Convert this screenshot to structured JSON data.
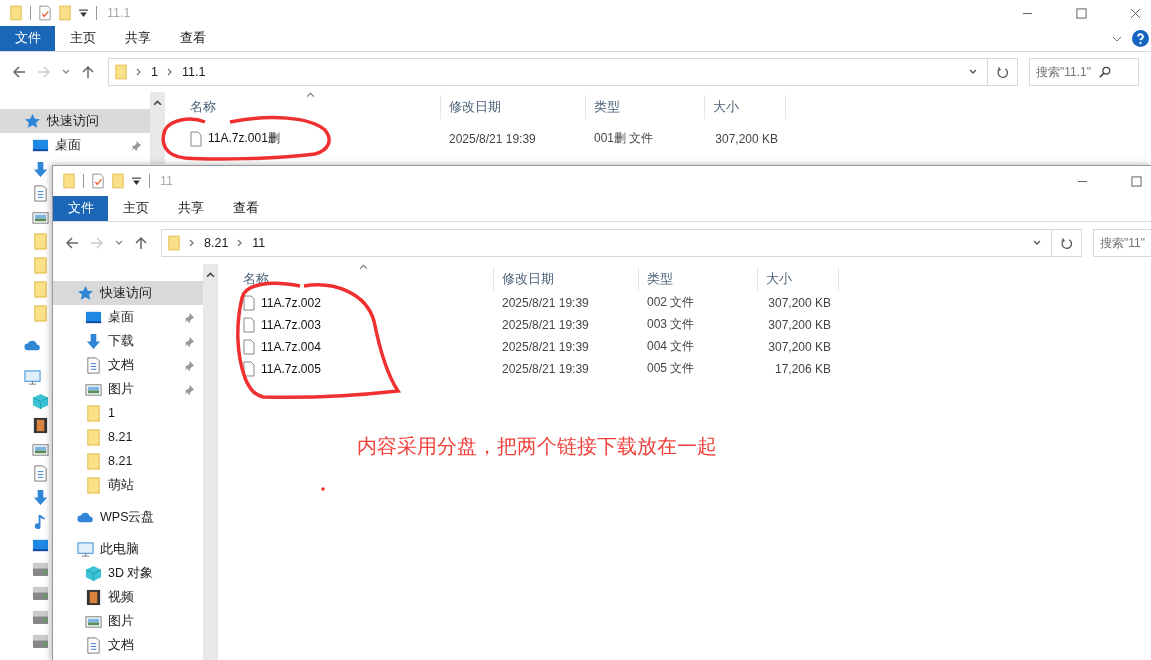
{
  "back_window": {
    "title": "11.1",
    "ribbon_tabs": [
      {
        "label": "文件",
        "selected": true
      },
      {
        "label": "主页",
        "selected": false
      },
      {
        "label": "共享",
        "selected": false
      },
      {
        "label": "查看",
        "selected": false
      }
    ],
    "path": [
      "1",
      "11.1"
    ],
    "search": {
      "placeholder": "搜索\"11.1\""
    },
    "sidebar": {
      "items": [
        {
          "kind": "quick",
          "label": "快速访问",
          "selected": true,
          "pinned": false
        },
        {
          "kind": "desktop",
          "label": "桌面",
          "selected": false,
          "pinned": true
        },
        {
          "kind": "download",
          "selected": false
        },
        {
          "kind": "document",
          "selected": false
        },
        {
          "kind": "picture",
          "selected": false
        },
        {
          "kind": "folder",
          "selected": false
        },
        {
          "kind": "folder",
          "selected": false
        },
        {
          "kind": "folder",
          "selected": false
        },
        {
          "kind": "folder",
          "selected": false
        },
        {
          "kind": "cloud",
          "selected": false
        },
        {
          "kind": "pc",
          "selected": false
        },
        {
          "kind": "cube",
          "selected": false
        },
        {
          "kind": "video",
          "selected": false
        },
        {
          "kind": "picture",
          "selected": false
        },
        {
          "kind": "document",
          "selected": false
        },
        {
          "kind": "download",
          "selected": false
        },
        {
          "kind": "music",
          "selected": false
        },
        {
          "kind": "desktop",
          "selected": false
        },
        {
          "kind": "drive",
          "selected": false
        },
        {
          "kind": "drive",
          "selected": false
        },
        {
          "kind": "drive",
          "selected": false
        },
        {
          "kind": "drive",
          "selected": false
        }
      ]
    },
    "columns": [
      "名称",
      "修改日期",
      "类型",
      "大小"
    ],
    "files": [
      {
        "name": "11A.7z.001删",
        "modified": "2025/8/21 19:39",
        "type": "001删 文件",
        "size": "307,200 KB"
      }
    ]
  },
  "front_window": {
    "title": "11",
    "ribbon_tabs": [
      {
        "label": "文件",
        "selected": true
      },
      {
        "label": "主页",
        "selected": false
      },
      {
        "label": "共享",
        "selected": false
      },
      {
        "label": "查看",
        "selected": false
      }
    ],
    "path": [
      "8.21",
      "11"
    ],
    "search": {
      "placeholder": "搜索\"11\""
    },
    "sidebar": {
      "items": [
        {
          "kind": "quick",
          "label": "快速访问",
          "selected": true,
          "pinned": false
        },
        {
          "kind": "desktop",
          "label": "桌面",
          "selected": false,
          "pinned": true
        },
        {
          "kind": "download",
          "label": "下载",
          "selected": false,
          "pinned": true
        },
        {
          "kind": "document",
          "label": "文档",
          "selected": false,
          "pinned": true
        },
        {
          "kind": "picture",
          "label": "图片",
          "selected": false,
          "pinned": true
        },
        {
          "kind": "folder",
          "label": "1",
          "selected": false,
          "pinned": false
        },
        {
          "kind": "folder",
          "label": "8.21",
          "selected": false,
          "pinned": false
        },
        {
          "kind": "folder",
          "label": "8.21",
          "selected": false,
          "pinned": false
        },
        {
          "kind": "folder",
          "label": "萌站",
          "selected": false,
          "pinned": false
        },
        {
          "kind": "cloud",
          "label": "WPS云盘",
          "selected": false,
          "pinned": false
        },
        {
          "kind": "pc",
          "label": "此电脑",
          "selected": false,
          "pinned": false
        },
        {
          "kind": "cube",
          "label": "3D 对象",
          "selected": false,
          "pinned": false
        },
        {
          "kind": "video",
          "label": "视频",
          "selected": false,
          "pinned": false
        },
        {
          "kind": "picture",
          "label": "图片",
          "selected": false,
          "pinned": false
        },
        {
          "kind": "document",
          "label": "文档",
          "selected": false,
          "pinned": false
        }
      ]
    },
    "columns": [
      "名称",
      "修改日期",
      "类型",
      "大小"
    ],
    "files": [
      {
        "name": "11A.7z.002",
        "modified": "2025/8/21 19:39",
        "type": "002 文件",
        "size": "307,200 KB"
      },
      {
        "name": "11A.7z.003",
        "modified": "2025/8/21 19:39",
        "type": "003 文件",
        "size": "307,200 KB"
      },
      {
        "name": "11A.7z.004",
        "modified": "2025/8/21 19:39",
        "type": "004 文件",
        "size": "307,200 KB"
      },
      {
        "name": "11A.7z.005",
        "modified": "2025/8/21 19:39",
        "type": "005 文件",
        "size": "17,206 KB"
      }
    ]
  },
  "annotations": {
    "note": "内容采用分盘，把两个链接下载放在一起"
  }
}
